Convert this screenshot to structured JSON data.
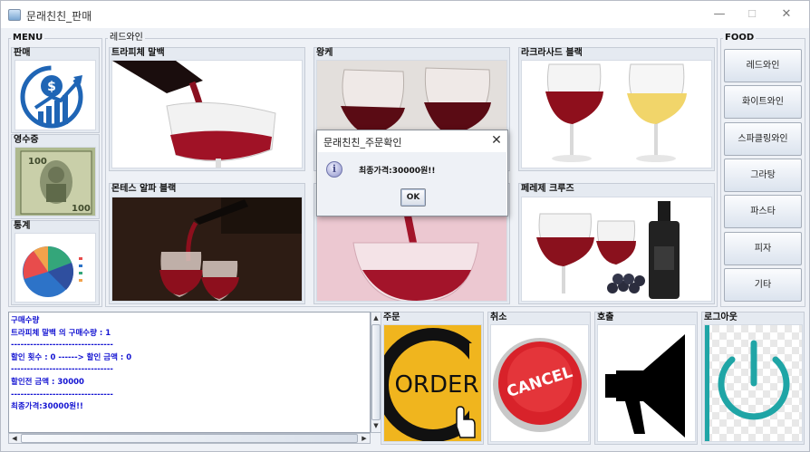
{
  "window": {
    "title": "문래친친_판매",
    "minimize": "—",
    "maximize": "☐",
    "close": "✕"
  },
  "menu": {
    "label": "MENU",
    "items": [
      {
        "label": "판매",
        "icon": "sales-chart-icon"
      },
      {
        "label": "영수증",
        "icon": "banknote-icon"
      },
      {
        "label": "통계",
        "icon": "pie-chart-icon"
      }
    ]
  },
  "wine": {
    "label": "레드와인",
    "items": [
      {
        "label": "트라피체 말백",
        "image": "wine-pour-glass"
      },
      {
        "label": "왕케",
        "image": "two-wine-glasses"
      },
      {
        "label": "라크라사드 블랙",
        "image": "red-and-white-wine"
      },
      {
        "label": "몬테스 알파 블랙",
        "image": "wine-pour-bottle"
      },
      {
        "label": "",
        "image": "wine-pour-pink"
      },
      {
        "label": "페레제 크루즈",
        "image": "wine-bottle-grapes"
      }
    ]
  },
  "food": {
    "label": "FOOD",
    "buttons": [
      "레드와인",
      "화이트와인",
      "스파클링와인",
      "그라탕",
      "파스타",
      "피자",
      "기타"
    ]
  },
  "receipt": {
    "lines": [
      "구매수량",
      "트라피체 말백 의 구매수량 : 1",
      "--------------------------------",
      "할인 횟수 : 0  ------>  할인 금액 : 0",
      "--------------------------------",
      "할인전 금액 : 30000",
      "--------------------------------",
      "최종가격:30000원!!"
    ]
  },
  "actions": [
    {
      "label": "주문",
      "image_text": "ORDER"
    },
    {
      "label": "취소",
      "image_text": "CANCEL"
    },
    {
      "label": "호출",
      "image_text": ""
    },
    {
      "label": "로그아웃",
      "image_text": ""
    }
  ],
  "dialog": {
    "title": "문래친친_주문확인",
    "message": "최종가격:30000원!!",
    "ok": "OK",
    "close": "✕"
  },
  "colors": {
    "receipt_text": "#1414d2",
    "order_yellow": "#f0b51e",
    "cancel_red": "#d8222a",
    "logout_teal": "#1fa5a6"
  }
}
